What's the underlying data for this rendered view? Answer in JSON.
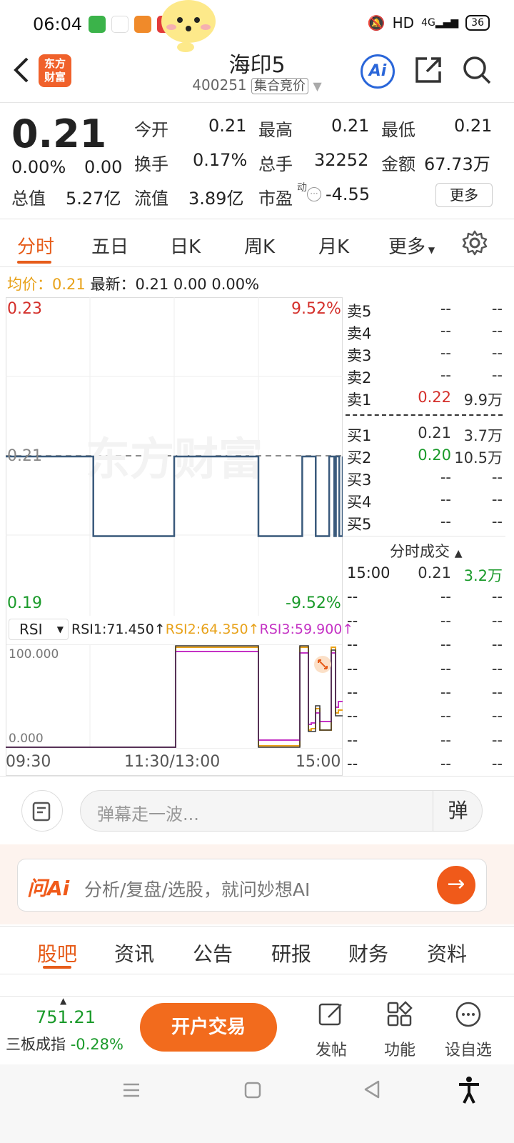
{
  "status_bar": {
    "time": "06:04",
    "network": "HD",
    "signal": "4G",
    "battery": "36"
  },
  "header": {
    "back_icon": "chevron-left-icon",
    "logo_text": "东方\n财富",
    "title": "海印5",
    "code": "400251",
    "badge": "集合竞价",
    "ai_label": "Ai"
  },
  "quote": {
    "price": "0.21",
    "change_pct": "0.00%",
    "change": "0.00",
    "fields": [
      {
        "label": "今开",
        "value": "0.21"
      },
      {
        "label": "最高",
        "value": "0.21"
      },
      {
        "label": "最低",
        "value": "0.21"
      },
      {
        "label": "换手",
        "value": "0.17%"
      },
      {
        "label": "总手",
        "value": "32252"
      },
      {
        "label": "金额",
        "value": "67.73万"
      },
      {
        "label": "总值",
        "value": "5.27亿"
      },
      {
        "label": "流值",
        "value": "3.89亿"
      },
      {
        "label": "市盈",
        "value": "-4.55"
      }
    ],
    "pe_sup": "动",
    "more_label": "更多"
  },
  "chart_tabs": [
    "分时",
    "五日",
    "日K",
    "周K",
    "月K",
    "更多"
  ],
  "info_line": {
    "avg_label": "均价：",
    "avg_value": "0.21",
    "latest_label": "最新：",
    "latest_value": "0.21",
    "change": "0.00",
    "change_pct": "0.00%"
  },
  "watermark": "东方财富",
  "chart_data": {
    "type": "line",
    "ylim": [
      0.19,
      0.23
    ],
    "y_left_labels": [
      "0.23",
      "0.21",
      "0.19"
    ],
    "y_right_labels": [
      "9.52%",
      "-9.52%"
    ],
    "x_ticks": [
      "09:30",
      "11:30/13:00",
      "15:00"
    ],
    "series": [
      {
        "x": [
          0,
          0.25,
          0.26,
          0.49,
          0.5,
          0.74,
          0.75,
          0.87,
          0.88,
          0.91,
          0.92,
          0.95,
          0.96,
          0.975,
          0.98,
          0.99,
          1.0
        ],
        "values": [
          0.21,
          0.21,
          0.2,
          0.2,
          0.21,
          0.21,
          0.2,
          0.2,
          0.21,
          0.21,
          0.2,
          0.2,
          0.21,
          0.2,
          0.21,
          0.2,
          0.21
        ]
      }
    ],
    "rsi": {
      "indicator": "RSI",
      "labels": [
        "RSI1:71.450↑",
        "RSI2:64.350↑",
        "RSI3:59.900↑"
      ],
      "ylim_labels": [
        "100.000",
        "0.000"
      ]
    }
  },
  "order_book": {
    "sell": [
      {
        "label": "卖5",
        "price": "--",
        "vol": "--"
      },
      {
        "label": "卖4",
        "price": "--",
        "vol": "--"
      },
      {
        "label": "卖3",
        "price": "--",
        "vol": "--"
      },
      {
        "label": "卖2",
        "price": "--",
        "vol": "--"
      },
      {
        "label": "卖1",
        "price": "0.22",
        "vol": "9.9万"
      }
    ],
    "buy": [
      {
        "label": "买1",
        "price": "0.21",
        "vol": "3.7万"
      },
      {
        "label": "买2",
        "price": "0.20",
        "vol": "10.5万"
      },
      {
        "label": "买3",
        "price": "--",
        "vol": "--"
      },
      {
        "label": "买4",
        "price": "--",
        "vol": "--"
      },
      {
        "label": "买5",
        "price": "--",
        "vol": "--"
      }
    ],
    "trades_title": "分时成交",
    "trades": [
      {
        "time": "15:00",
        "price": "0.21",
        "vol": "3.2万"
      },
      {
        "time": "--",
        "price": "--",
        "vol": "--"
      },
      {
        "time": "--",
        "price": "--",
        "vol": "--"
      },
      {
        "time": "--",
        "price": "--",
        "vol": "--"
      },
      {
        "time": "--",
        "price": "--",
        "vol": "--"
      },
      {
        "time": "--",
        "price": "--",
        "vol": "--"
      },
      {
        "time": "--",
        "price": "--",
        "vol": "--"
      },
      {
        "time": "--",
        "price": "--",
        "vol": "--"
      },
      {
        "time": "--",
        "price": "--",
        "vol": "--"
      }
    ]
  },
  "comment": {
    "placeholder": "弹幕走一波...",
    "danmu_label": "弹"
  },
  "ai_bar": {
    "brand": "问Ai",
    "prompt": "分析/复盘/选股，就问妙想AI"
  },
  "bottom_tabs": [
    "股吧",
    "资讯",
    "公告",
    "研报",
    "财务",
    "资料"
  ],
  "bottom_bar": {
    "index_value": "751.21",
    "index_name": "三板成指",
    "index_change": "-0.28%",
    "trade_label": "开户交易",
    "post_label": "发帖",
    "function_label": "功能",
    "watchlist_label": "设自选"
  },
  "colors": {
    "accent": "#e65c1a",
    "up": "#d4302b",
    "down": "#1a9a2a",
    "line": "#3a5a7c",
    "rsi2": "#e8a21a",
    "rsi3": "#c432c4"
  }
}
